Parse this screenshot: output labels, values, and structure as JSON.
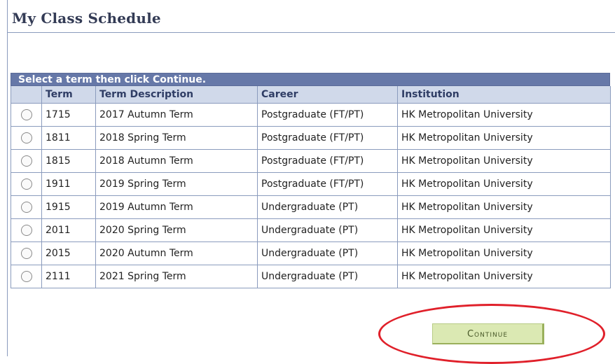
{
  "page": {
    "title": "My Class Schedule"
  },
  "grid": {
    "instruction": "Select a term then click Continue.",
    "columns": [
      "",
      "Term",
      "Term Description",
      "Career",
      "Institution"
    ],
    "rows": [
      {
        "term": "1715",
        "description": "2017 Autumn Term",
        "career": "Postgraduate (FT/PT)",
        "institution": "HK Metropolitan University"
      },
      {
        "term": "1811",
        "description": "2018 Spring Term",
        "career": "Postgraduate (FT/PT)",
        "institution": "HK Metropolitan University"
      },
      {
        "term": "1815",
        "description": "2018 Autumn Term",
        "career": "Postgraduate (FT/PT)",
        "institution": "HK Metropolitan University"
      },
      {
        "term": "1911",
        "description": "2019 Spring Term",
        "career": "Postgraduate (FT/PT)",
        "institution": "HK Metropolitan University"
      },
      {
        "term": "1915",
        "description": "2019 Autumn Term",
        "career": "Undergraduate (PT)",
        "institution": "HK Metropolitan University"
      },
      {
        "term": "2011",
        "description": "2020 Spring Term",
        "career": "Undergraduate (PT)",
        "institution": "HK Metropolitan University"
      },
      {
        "term": "2015",
        "description": "2020 Autumn Term",
        "career": "Undergraduate (PT)",
        "institution": "HK Metropolitan University"
      },
      {
        "term": "2111",
        "description": "2021 Spring Term",
        "career": "Undergraduate (PT)",
        "institution": "HK Metropolitan University"
      }
    ]
  },
  "actions": {
    "continue_label": "Continue"
  },
  "colors": {
    "header_bar": "#6678a8",
    "column_header": "#d0d9ea",
    "button": "#dbe9b3",
    "highlight": "#e0202a"
  }
}
